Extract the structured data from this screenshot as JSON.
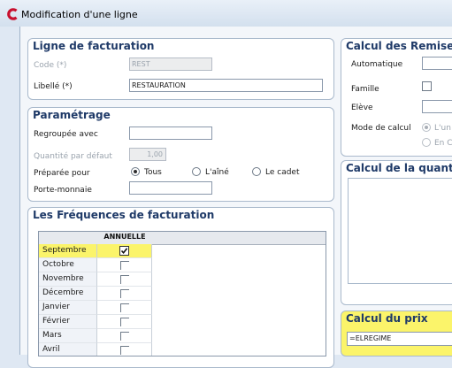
{
  "window": {
    "title": "Modification d'une ligne"
  },
  "ligne_facturation": {
    "header": "Ligne de facturation",
    "code": {
      "label": "Code (*)",
      "value": "REST"
    },
    "libelle": {
      "label": "Libellé (*)",
      "value": "RESTAURATION"
    }
  },
  "parametrage": {
    "header": "Paramétrage",
    "regroupee": {
      "label": "Regroupée avec",
      "value": ""
    },
    "quantite": {
      "label": "Quantité par défaut",
      "value": "1,00"
    },
    "preparee": {
      "label": "Préparée pour",
      "options": [
        "Tous",
        "L'aîné",
        "Le cadet"
      ],
      "selected": "Tous"
    },
    "porte_monnaie": {
      "label": "Porte-monnaie",
      "value": ""
    }
  },
  "frequences": {
    "header": "Les Fréquences de facturation",
    "column": "ANNUELLE",
    "months": [
      "Septembre",
      "Octobre",
      "Novembre",
      "Décembre",
      "Janvier",
      "Février",
      "Mars",
      "Avril"
    ],
    "checked": [
      "Septembre"
    ],
    "highlighted": [
      "Septembre"
    ]
  },
  "remises": {
    "header": "Calcul des Remises",
    "automatique": "Automatique",
    "famille": "Famille",
    "eleve": "Elève",
    "mode": "Mode de calcul",
    "mode_options": [
      "L'un",
      "En C"
    ],
    "mode_selected": "L'un"
  },
  "quantite_calc": {
    "header": "Calcul de la quantite"
  },
  "prix": {
    "header": "Calcul du prix",
    "value": "=ELREGIME"
  },
  "colors": {
    "accent": "#1f3a68",
    "highlight": "#fbf46a",
    "icon": "#c8102e"
  }
}
